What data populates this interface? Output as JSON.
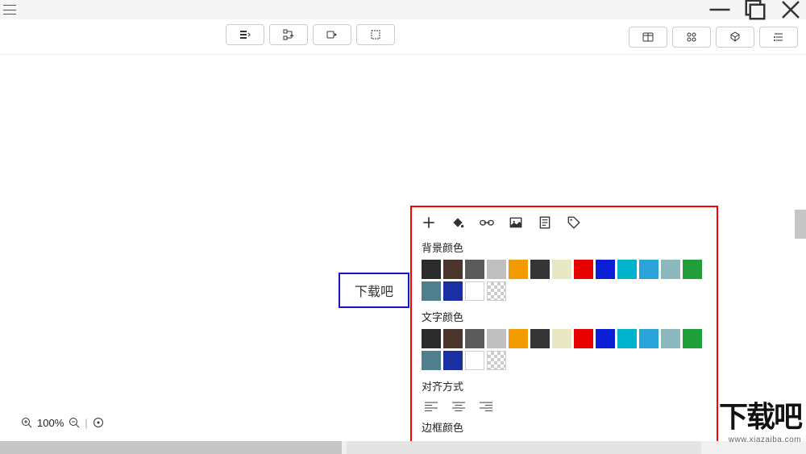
{
  "window": {
    "controls": {
      "minimize": "minimize",
      "maximize": "maximize",
      "close": "close"
    }
  },
  "toolbar": {
    "left": [
      "tool1",
      "tool2",
      "tool3",
      "tool4"
    ],
    "right": [
      "panel1",
      "panel2",
      "panel3",
      "panel4"
    ]
  },
  "node": {
    "text": "下载吧"
  },
  "popup": {
    "tools": [
      "add",
      "fill",
      "link",
      "image",
      "note",
      "tag"
    ],
    "bg_label": "背景颜色",
    "text_label": "文字颜色",
    "align_label": "对齐方式",
    "border_label": "边框颜色",
    "bg_colors": [
      "#2b2b2b",
      "#4a342b",
      "#5a5a5a",
      "#bfbfbf",
      "#f29b00",
      "#353535",
      "#e8e8c4",
      "#e60000",
      "#0a1fd6",
      "#00b3cc",
      "#2aa3d9",
      "#8bb9bd",
      "#1f9e3a",
      "#4f7e8c",
      "#1a2fa3",
      "#ffffff",
      "transparent"
    ],
    "text_colors": [
      "#2b2b2b",
      "#4a342b",
      "#5a5a5a",
      "#bfbfbf",
      "#f29b00",
      "#353535",
      "#e8e8c4",
      "#e60000",
      "#0a1fd6",
      "#00b3cc",
      "#2aa3d9",
      "#8bb9bd",
      "#1f9e3a",
      "#4f7e8c",
      "#1a2fa3",
      "#ffffff",
      "transparent"
    ],
    "align_options": [
      "left",
      "center",
      "right"
    ]
  },
  "status": {
    "zoom": "100%"
  },
  "watermark": {
    "brand": "下载吧",
    "url": "www.xiazaiba.com"
  }
}
